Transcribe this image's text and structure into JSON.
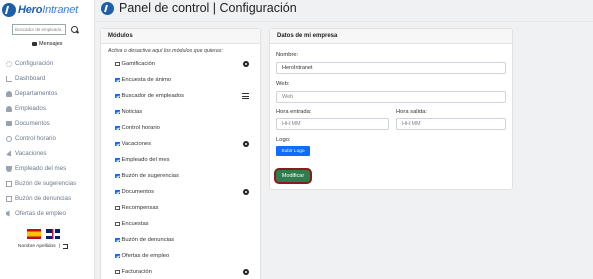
{
  "brand": {
    "name_bold": "Hero",
    "name_light": "Intranet"
  },
  "search": {
    "placeholder": "Buscador de empleado..."
  },
  "messages": {
    "label": "Mensajes"
  },
  "nav": {
    "items": [
      {
        "label": "Configuración",
        "icon": "gear-icon"
      },
      {
        "label": "Dashboard",
        "icon": "chart-icon"
      },
      {
        "label": "Departamentos",
        "icon": "people-icon"
      },
      {
        "label": "Empleados",
        "icon": "user-icon"
      },
      {
        "label": "Documentos",
        "icon": "folder-icon"
      },
      {
        "label": "Control horario",
        "icon": "clock-icon"
      },
      {
        "label": "Vacaciones",
        "icon": "plane-icon"
      },
      {
        "label": "Empleado del mes",
        "icon": "trophy-icon"
      },
      {
        "label": "Buzón de sugerencias",
        "icon": "inbox-icon"
      },
      {
        "label": "Buzón de denuncias",
        "icon": "inbox-icon"
      },
      {
        "label": "Ofertas de empleo",
        "icon": "megaphone-icon"
      }
    ]
  },
  "user": {
    "name": "Nombre Apellidos",
    "separator": "|"
  },
  "header": {
    "title": "Panel de control | Configuración"
  },
  "modules": {
    "title": "Módulos",
    "intro": "Activa o desactiva aquí los módulos que quieras:",
    "items": [
      {
        "label": "Gamificación",
        "checked": false,
        "action": "gear-icon"
      },
      {
        "label": "Encuesta de ánimo",
        "checked": true,
        "action": ""
      },
      {
        "label": "Buscador de empleados",
        "checked": true,
        "action": "list-icon"
      },
      {
        "label": "Noticias",
        "checked": true,
        "action": ""
      },
      {
        "label": "Control horario",
        "checked": true,
        "action": ""
      },
      {
        "label": "Vacaciones",
        "checked": true,
        "action": "gear-icon"
      },
      {
        "label": "Empleado del mes",
        "checked": true,
        "action": ""
      },
      {
        "label": "Buzón de sugerencias",
        "checked": true,
        "action": ""
      },
      {
        "label": "Documentos",
        "checked": true,
        "action": "gear-icon"
      },
      {
        "label": "Recompensas",
        "checked": false,
        "action": ""
      },
      {
        "label": "Encuestas",
        "checked": false,
        "action": ""
      },
      {
        "label": "Buzón de denuncias",
        "checked": true,
        "action": ""
      },
      {
        "label": "Ofertas de empleo",
        "checked": true,
        "action": ""
      },
      {
        "label": "Facturación",
        "checked": false,
        "action": "gear-icon"
      }
    ]
  },
  "company": {
    "title": "Datos de mi empresa",
    "name_label": "Nombre:",
    "name_value": "HeroIntranet",
    "web_label": "Web:",
    "web_placeholder": "Web",
    "start_label": "Hora entrada:",
    "start_placeholder": "HH:MM",
    "end_label": "Hora salida:",
    "end_placeholder": "HH:MM",
    "logo_label": "Logo:",
    "upload_label": "Subir Logo",
    "submit_label": "Modificar"
  },
  "colors": {
    "brand": "#1f5ea8",
    "primary": "#0d6efd",
    "submit": "#2e7d4f",
    "submit_border": "#8b1a1a"
  }
}
